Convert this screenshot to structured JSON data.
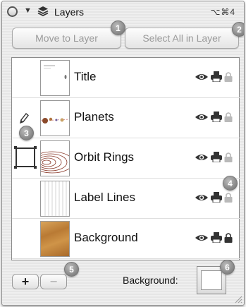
{
  "window": {
    "title": "Layers",
    "shortcut": "⌥⌘4"
  },
  "toolbar": {
    "move_to_layer": "Move to Layer",
    "select_all_in_layer": "Select All in Layer"
  },
  "callouts": [
    "1",
    "2",
    "3",
    "4",
    "5",
    "6"
  ],
  "layers": [
    {
      "name": "Title",
      "visible": true,
      "printable": true,
      "locked": false
    },
    {
      "name": "Planets",
      "visible": true,
      "printable": true,
      "locked": false,
      "editing": true
    },
    {
      "name": "Orbit Rings",
      "visible": true,
      "printable": true,
      "locked": false,
      "selected": true
    },
    {
      "name": "Label Lines",
      "visible": true,
      "printable": true,
      "locked": false
    },
    {
      "name": "Background",
      "visible": true,
      "printable": true,
      "locked": true
    }
  ],
  "footer": {
    "add": "+",
    "remove": "−",
    "background_label": "Background:",
    "background_color": "#ffffff"
  },
  "colors": {
    "icon_active": "#333333",
    "icon_inactive": "#b9b9b9",
    "badge": "#8c8c8c"
  }
}
